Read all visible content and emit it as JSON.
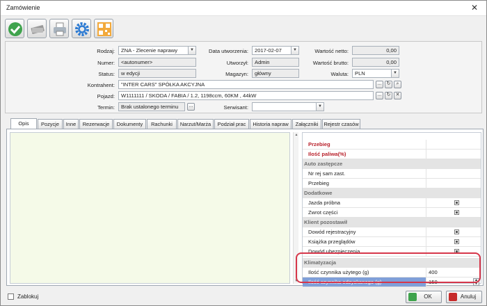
{
  "window": {
    "title": "Zamówienie",
    "close_glyph": "✕"
  },
  "toolbar": {
    "icons": [
      "check-icon",
      "banknote-icon",
      "printer-icon",
      "gear-icon",
      "qr-code-icon"
    ]
  },
  "form": {
    "rodzaj": {
      "label": "Rodzaj:",
      "value": "ZNA - Zlecenie naprawy"
    },
    "numer": {
      "label": "Numer:",
      "value": "<autonumer>"
    },
    "status": {
      "label": "Status:",
      "value": "w edycji"
    },
    "data_utw": {
      "label": "Data utworzenia:",
      "value": "2017-02-07"
    },
    "utworzyl": {
      "label": "Utworzył:",
      "value": "Admin"
    },
    "magazyn": {
      "label": "Magazyn:",
      "value": "główny"
    },
    "netto": {
      "label": "Wartość netto:",
      "value": "0,00"
    },
    "brutto": {
      "label": "Wartość brutto:",
      "value": "0,00"
    },
    "waluta": {
      "label": "Waluta:",
      "value": "PLN"
    },
    "kontrahent": {
      "label": "Kontrahent:",
      "value": "\"INTER CARS\" SPÓŁKA AKCYJNA"
    },
    "pojazd": {
      "label": "Pojazd:",
      "value": "W1111111 / SKODA / FABIA / 1.2, 1198ccm, 60KM , 44kW"
    },
    "termin": {
      "label": "Termin:",
      "value": "Brak ustalonego terminu"
    },
    "serwisant": {
      "label": "Serwisant:",
      "value": ""
    },
    "ellipsis": "...",
    "dd_glyph": "▼"
  },
  "tabs": [
    "Opis",
    "Pozycje",
    "Inne",
    "Rezerwacje",
    "Dokumenty",
    "Rachunki",
    "Narzut/Marża",
    "Podział prac",
    "Historia napraw",
    "Załączniki",
    "Rejestr czasów"
  ],
  "grid": {
    "przebieg_top": "Przebieg",
    "paliwo": "Ilość paliwa(%)",
    "cat_auto": "Auto zastępcze",
    "nr_rej": "Nr rej sam zast.",
    "przebieg": "Przebieg",
    "cat_dod": "Dodatkowe",
    "jazda": "Jazda próbna",
    "zwrot": "Zwrot części",
    "cat_klient": "Klient pozostawił",
    "dowod_rej": "Dowód rejestracyjny",
    "ksiazka": "Książka przeglądów",
    "dowod_ub": "Dowód ubezpieczenia",
    "cat_klima": "Klimatyzacja",
    "uzyty": {
      "label": "Ilość czynnika użytego (g)",
      "value": "400"
    },
    "odzyskany": {
      "label": "Ilość czynnika odzyskanego (g)",
      "value": "150"
    }
  },
  "footer": {
    "zablokuj": "Zablokuj",
    "ok": "OK",
    "anuluj": "Anuluj"
  },
  "colors": {
    "red_label": "#b8202a",
    "highlight": "#d6364a",
    "selection": "#7f9fd9",
    "memo_bg": "#f5fae8"
  }
}
